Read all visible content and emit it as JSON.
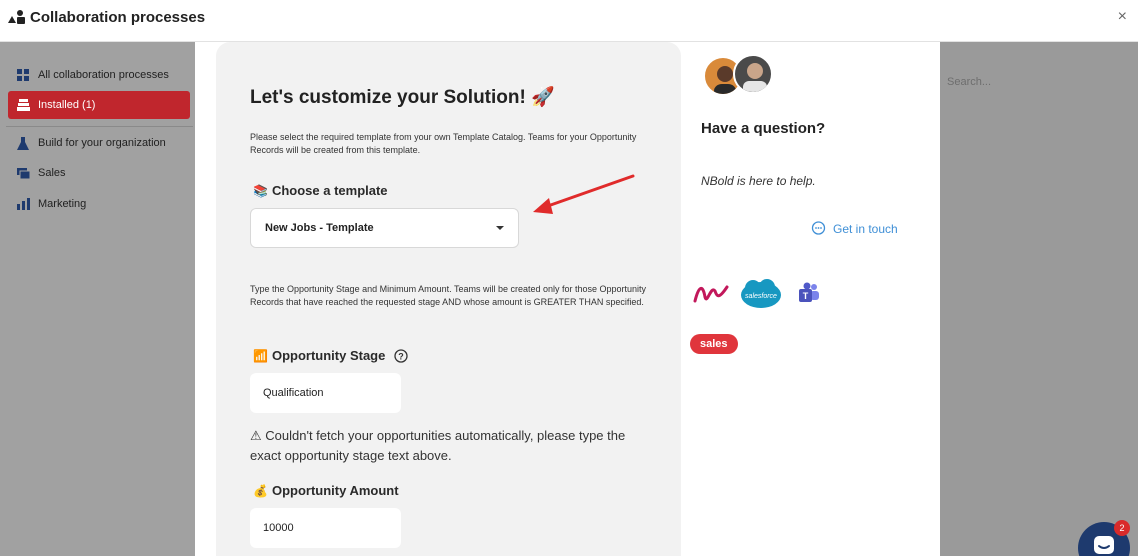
{
  "header": {
    "title": "Collaboration processes",
    "close_glyph": "×"
  },
  "sidebar": {
    "items": [
      {
        "label": "All collaboration processes",
        "icon": "grid-icon"
      },
      {
        "label": "Installed (1)",
        "icon": "stack-icon",
        "active": true
      },
      {
        "label": "Build for your organization",
        "icon": "flask-icon"
      },
      {
        "label": "Sales",
        "icon": "cash-icon"
      },
      {
        "label": "Marketing",
        "icon": "bar-chart-icon"
      }
    ],
    "search_placeholder": "Search..."
  },
  "form": {
    "title": "Let's customize your Solution! 🚀",
    "intro": "Please select the required template from your own Template Catalog. Teams for your Opportunity Records will be created from this template.",
    "template_label": "Choose a template",
    "template_emoji": "📚",
    "template_value": "New Jobs - Template",
    "stage_intro": "Type the Opportunity Stage and Minimum Amount. Teams will be created only for those Opportunity Records that have reached the requested stage AND whose amount is GREATER THAN specified.",
    "stage_label": "Opportunity Stage",
    "stage_emoji": "📶",
    "stage_value": "Qualification",
    "warning": "⚠ Couldn't fetch your opportunities automatically, please type the exact opportunity stage text above.",
    "amount_label": "Opportunity Amount",
    "amount_emoji": "💰",
    "amount_value": "10000"
  },
  "help": {
    "title": "Have a question?",
    "subtitle": "NBold is here to help.",
    "contact_label": "Get in touch",
    "tag": "sales",
    "logo_salesforce": "salesforce"
  },
  "chat": {
    "badge": "2"
  },
  "colors": {
    "accent_red": "#c0262d",
    "link_blue": "#3f8fd6",
    "tag_red": "#e0353c"
  }
}
